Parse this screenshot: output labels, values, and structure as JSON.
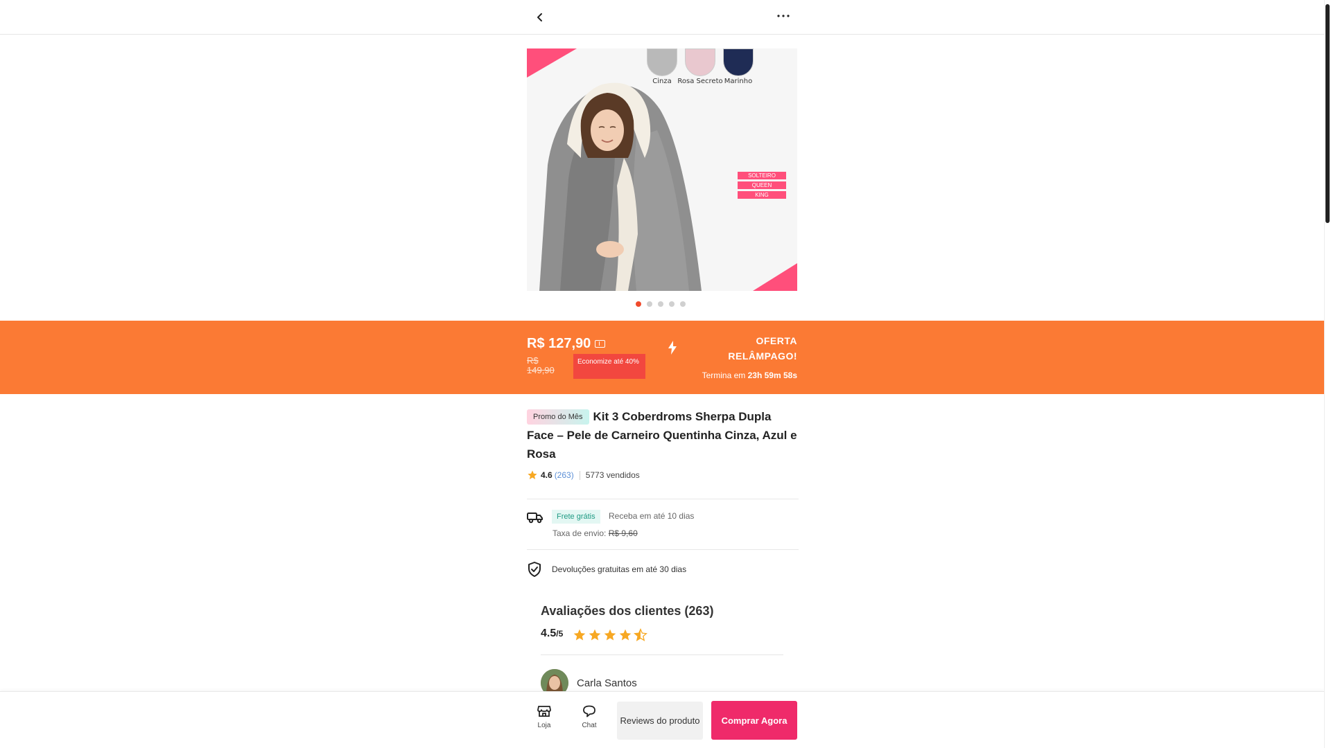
{
  "nav": {
    "back_icon": "chevron-left-icon",
    "more_icon": "more-horizontal-icon"
  },
  "product_image": {
    "swatches": [
      {
        "label": "Cinza",
        "color": "#b9b9b9"
      },
      {
        "label": "Rosa Secreto",
        "color": "#e9c8cf"
      },
      {
        "label": "Marinho",
        "color": "#1f2c55"
      }
    ],
    "sizes": [
      "SOLTEIRO",
      "QUEEN",
      "KING"
    ],
    "accent": "#ff4f7b",
    "carousel_total": 5,
    "carousel_active": 1
  },
  "flash": {
    "price": "R$ 127,90",
    "old_price": "R$ 149,90",
    "save_label": "Economize até 40%",
    "title": "OFERTA RELÂMPAGO!",
    "countdown_label": "Termina em",
    "countdown_value": "23h 59m 58s",
    "bg_color": "#fb7a34"
  },
  "product": {
    "promo_badge": "Promo do Mês",
    "title": "Kit 3 Coberdroms Sherpa Dupla Face – Pele de Carneiro Quentinha Cinza, Azul e Rosa",
    "rating": "4.6",
    "rating_count": "(263)",
    "sold": "5773 vendidos"
  },
  "shipping": {
    "free_label": "Frete grátis",
    "delivery": "Receba em até 10 dias",
    "fee_label": "Taxa de envio:",
    "fee_old": "R$ 9,60"
  },
  "returns": {
    "text": "Devoluções gratuitas em até 30 dias"
  },
  "reviews": {
    "title": "Avaliações dos clientes (263)",
    "score": "4.5",
    "score_max": "/5",
    "stars": 4.5,
    "first_reviewer": "Carla Santos"
  },
  "bottom": {
    "store_label": "Loja",
    "chat_label": "Chat",
    "reviews_button": "Reviews do produto",
    "buy_button": "Comprar Agora",
    "buy_color": "#ef2a6a"
  }
}
